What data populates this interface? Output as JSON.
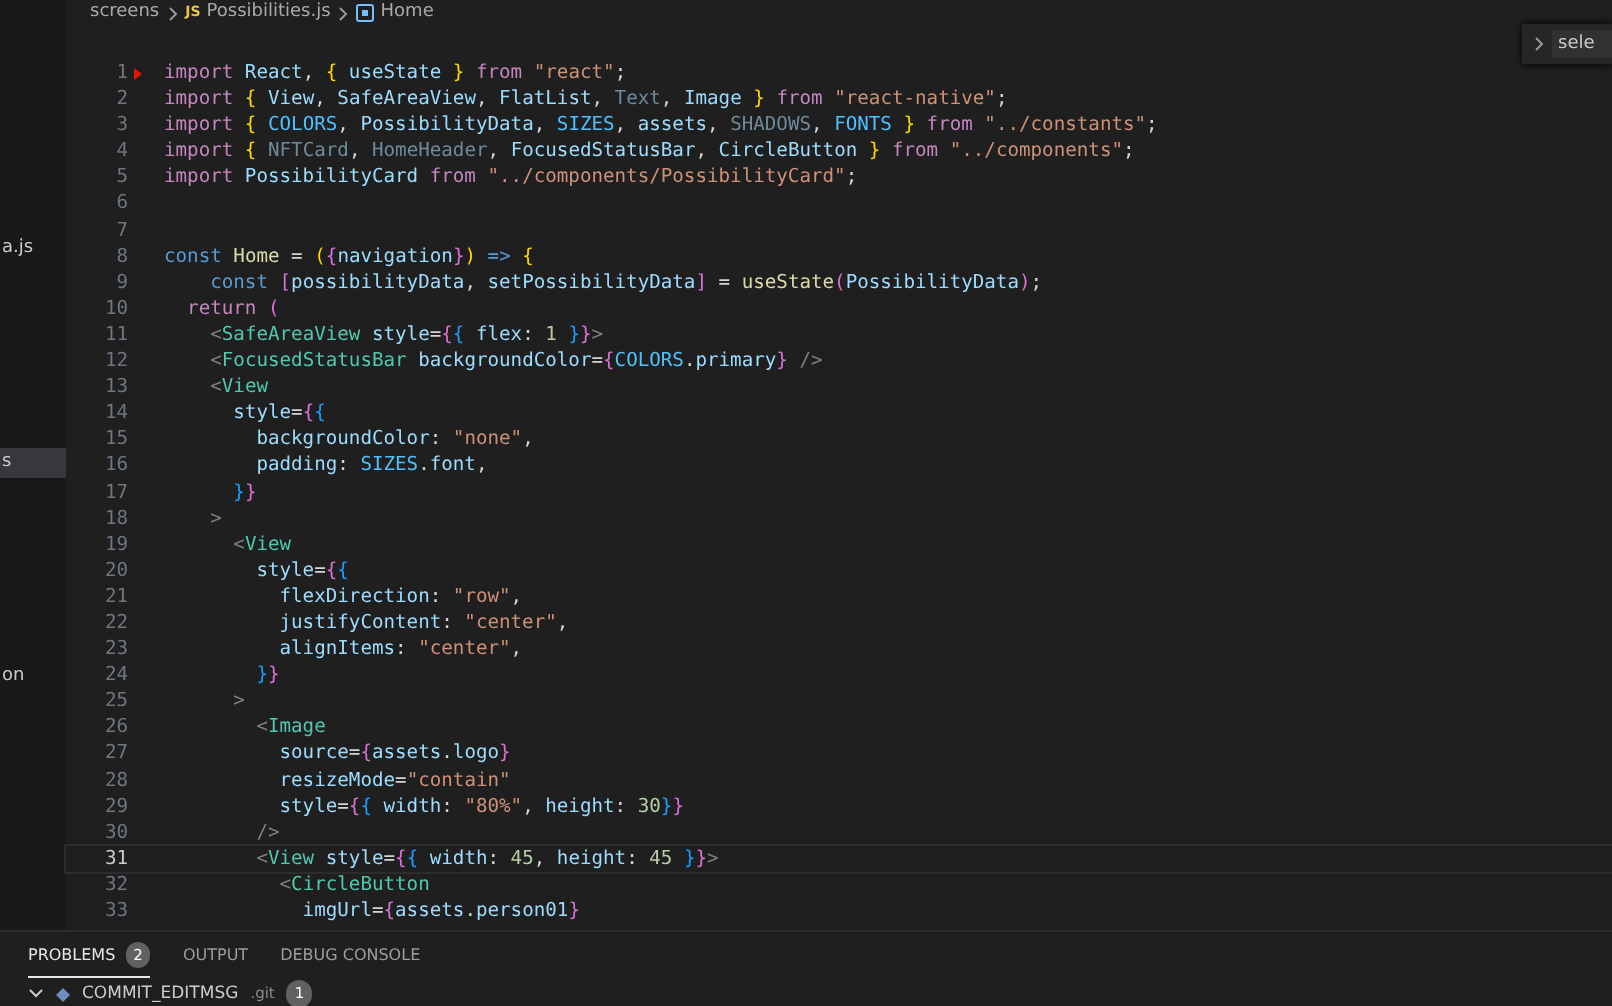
{
  "sidebar": {
    "items": [
      {
        "label": "a.js",
        "selected": false
      },
      {
        "label": "s",
        "selected": true
      },
      {
        "label": "on",
        "selected": false
      }
    ]
  },
  "breadcrumb": {
    "folder": "screens",
    "file_badge": "JS",
    "file": "Possibilities.js",
    "symbol": "Home"
  },
  "find_widget": {
    "value": "sele"
  },
  "editor": {
    "lines": [
      {
        "n": "1",
        "current": false,
        "flagged": true,
        "tokens": [
          {
            "kind": "kw",
            "text": "import"
          },
          {
            "kind": "var",
            "text": " React"
          },
          {
            "kind": "p",
            "text": ", "
          },
          {
            "kind": "b1",
            "text": "{"
          },
          {
            "kind": "var",
            "text": " useState "
          },
          {
            "kind": "b1",
            "text": "}"
          },
          {
            "kind": "kw",
            "text": " from"
          },
          {
            "kind": "str",
            "text": " \"react\""
          },
          {
            "kind": "p",
            "text": ";"
          }
        ]
      },
      {
        "n": "2",
        "current": false,
        "flagged": false,
        "tokens": [
          {
            "kind": "kw",
            "text": "import"
          },
          {
            "kind": "b1",
            "text": " {"
          },
          {
            "kind": "var",
            "text": " View"
          },
          {
            "kind": "p",
            "text": ","
          },
          {
            "kind": "var",
            "text": " SafeAreaView"
          },
          {
            "kind": "p",
            "text": ","
          },
          {
            "kind": "var",
            "text": " FlatList"
          },
          {
            "kind": "p",
            "text": ","
          },
          {
            "kind": "dim",
            "text": " Text"
          },
          {
            "kind": "p",
            "text": ","
          },
          {
            "kind": "var",
            "text": " Image"
          },
          {
            "kind": "b1",
            "text": " }"
          },
          {
            "kind": "kw",
            "text": " from"
          },
          {
            "kind": "str",
            "text": " \"react-native\""
          },
          {
            "kind": "p",
            "text": ";"
          }
        ]
      },
      {
        "n": "3",
        "current": false,
        "flagged": false,
        "tokens": [
          {
            "kind": "kw",
            "text": "import"
          },
          {
            "kind": "b1",
            "text": " {"
          },
          {
            "kind": "cst",
            "text": " COLORS"
          },
          {
            "kind": "p",
            "text": ","
          },
          {
            "kind": "var",
            "text": " PossibilityData"
          },
          {
            "kind": "p",
            "text": ","
          },
          {
            "kind": "cst",
            "text": " SIZES"
          },
          {
            "kind": "p",
            "text": ","
          },
          {
            "kind": "var",
            "text": " assets"
          },
          {
            "kind": "p",
            "text": ","
          },
          {
            "kind": "dim",
            "text": " SHADOWS"
          },
          {
            "kind": "p",
            "text": ","
          },
          {
            "kind": "cst",
            "text": " FONTS"
          },
          {
            "kind": "b1",
            "text": " }"
          },
          {
            "kind": "kw",
            "text": " from"
          },
          {
            "kind": "str",
            "text": " \"../constants\""
          },
          {
            "kind": "p",
            "text": ";"
          }
        ]
      },
      {
        "n": "4",
        "current": false,
        "flagged": false,
        "tokens": [
          {
            "kind": "kw",
            "text": "import"
          },
          {
            "kind": "b1",
            "text": " {"
          },
          {
            "kind": "dim",
            "text": " NFTCard"
          },
          {
            "kind": "p",
            "text": ","
          },
          {
            "kind": "dim",
            "text": " HomeHeader"
          },
          {
            "kind": "p",
            "text": ","
          },
          {
            "kind": "var",
            "text": " FocusedStatusBar"
          },
          {
            "kind": "p",
            "text": ","
          },
          {
            "kind": "var",
            "text": " CircleButton"
          },
          {
            "kind": "b1",
            "text": " }"
          },
          {
            "kind": "kw",
            "text": " from"
          },
          {
            "kind": "str",
            "text": " \"../components\""
          },
          {
            "kind": "p",
            "text": ";"
          }
        ]
      },
      {
        "n": "5",
        "current": false,
        "flagged": false,
        "tokens": [
          {
            "kind": "kw",
            "text": "import"
          },
          {
            "kind": "var",
            "text": " PossibilityCard"
          },
          {
            "kind": "kw",
            "text": " from"
          },
          {
            "kind": "str",
            "text": " \"../components/PossibilityCard\""
          },
          {
            "kind": "p",
            "text": ";"
          }
        ]
      },
      {
        "n": "6",
        "current": false,
        "flagged": false
      },
      {
        "n": "7",
        "current": false,
        "flagged": false
      },
      {
        "n": "8",
        "current": false,
        "flagged": false,
        "tokens": [
          {
            "kind": "kw2",
            "text": "const"
          },
          {
            "kind": "fn",
            "text": " Home"
          },
          {
            "kind": "p",
            "text": " ="
          },
          {
            "kind": "b1",
            "text": " ("
          },
          {
            "kind": "b2",
            "text": "{"
          },
          {
            "kind": "var",
            "text": "navigation"
          },
          {
            "kind": "b2",
            "text": "}"
          },
          {
            "kind": "b1",
            "text": ")"
          },
          {
            "kind": "kw2",
            "text": " =>"
          },
          {
            "kind": "b1",
            "text": " {"
          }
        ]
      },
      {
        "n": "9",
        "current": false,
        "flagged": false,
        "tokens": [
          {
            "kind": "kw2",
            "text": "    const"
          },
          {
            "kind": "b2",
            "text": " ["
          },
          {
            "kind": "var",
            "text": "possibilityData"
          },
          {
            "kind": "p",
            "text": ","
          },
          {
            "kind": "var",
            "text": " setPossibilityData"
          },
          {
            "kind": "b2",
            "text": "]"
          },
          {
            "kind": "p",
            "text": " ="
          },
          {
            "kind": "fn",
            "text": " useState"
          },
          {
            "kind": "b2",
            "text": "("
          },
          {
            "kind": "var",
            "text": "PossibilityData"
          },
          {
            "kind": "b2",
            "text": ")"
          },
          {
            "kind": "p",
            "text": ";"
          }
        ]
      },
      {
        "n": "10",
        "current": false,
        "flagged": false,
        "tokens": [
          {
            "kind": "kw",
            "text": "  return"
          },
          {
            "kind": "b2",
            "text": " ("
          }
        ]
      },
      {
        "n": "11",
        "current": false,
        "flagged": false,
        "tokens": [
          {
            "kind": "pu",
            "text": "    <"
          },
          {
            "kind": "tag",
            "text": "SafeAreaView"
          },
          {
            "kind": "var",
            "text": " style"
          },
          {
            "kind": "p",
            "text": "="
          },
          {
            "kind": "b2",
            "text": "{"
          },
          {
            "kind": "b3",
            "text": "{"
          },
          {
            "kind": "var",
            "text": " flex"
          },
          {
            "kind": "p",
            "text": ":"
          },
          {
            "kind": "num",
            "text": " 1"
          },
          {
            "kind": "b3",
            "text": " }"
          },
          {
            "kind": "b2",
            "text": "}"
          },
          {
            "kind": "pu",
            "text": ">"
          }
        ]
      },
      {
        "n": "12",
        "current": false,
        "flagged": false,
        "tokens": [
          {
            "kind": "pu",
            "text": "    <"
          },
          {
            "kind": "tag",
            "text": "FocusedStatusBar"
          },
          {
            "kind": "var",
            "text": " backgroundColor"
          },
          {
            "kind": "p",
            "text": "="
          },
          {
            "kind": "b2",
            "text": "{"
          },
          {
            "kind": "cst",
            "text": "COLORS"
          },
          {
            "kind": "p",
            "text": "."
          },
          {
            "kind": "var",
            "text": "primary"
          },
          {
            "kind": "b2",
            "text": "}"
          },
          {
            "kind": "pu",
            "text": " />"
          }
        ]
      },
      {
        "n": "13",
        "current": false,
        "flagged": false,
        "tokens": [
          {
            "kind": "pu",
            "text": "    <"
          },
          {
            "kind": "tag",
            "text": "View"
          }
        ]
      },
      {
        "n": "14",
        "current": false,
        "flagged": false,
        "tokens": [
          {
            "kind": "var",
            "text": "      style"
          },
          {
            "kind": "p",
            "text": "="
          },
          {
            "kind": "b2",
            "text": "{"
          },
          {
            "kind": "b3",
            "text": "{"
          }
        ]
      },
      {
        "n": "15",
        "current": false,
        "flagged": false,
        "tokens": [
          {
            "kind": "var",
            "text": "        backgroundColor"
          },
          {
            "kind": "p",
            "text": ":"
          },
          {
            "kind": "str",
            "text": " \"none\""
          },
          {
            "kind": "p",
            "text": ","
          }
        ]
      },
      {
        "n": "16",
        "current": false,
        "flagged": false,
        "tokens": [
          {
            "kind": "var",
            "text": "        padding"
          },
          {
            "kind": "p",
            "text": ":"
          },
          {
            "kind": "cst",
            "text": " SIZES"
          },
          {
            "kind": "p",
            "text": "."
          },
          {
            "kind": "var",
            "text": "font"
          },
          {
            "kind": "p",
            "text": ","
          }
        ]
      },
      {
        "n": "17",
        "current": false,
        "flagged": false,
        "tokens": [
          {
            "kind": "b3",
            "text": "      }"
          },
          {
            "kind": "b2",
            "text": "}"
          }
        ]
      },
      {
        "n": "18",
        "current": false,
        "flagged": false,
        "tokens": [
          {
            "kind": "pu",
            "text": "    >"
          }
        ]
      },
      {
        "n": "19",
        "current": false,
        "flagged": false,
        "tokens": [
          {
            "kind": "pu",
            "text": "      <"
          },
          {
            "kind": "tag",
            "text": "View"
          }
        ]
      },
      {
        "n": "20",
        "current": false,
        "flagged": false,
        "tokens": [
          {
            "kind": "var",
            "text": "        style"
          },
          {
            "kind": "p",
            "text": "="
          },
          {
            "kind": "b2",
            "text": "{"
          },
          {
            "kind": "b3",
            "text": "{"
          }
        ]
      },
      {
        "n": "21",
        "current": false,
        "flagged": false,
        "tokens": [
          {
            "kind": "var",
            "text": "          flexDirection"
          },
          {
            "kind": "p",
            "text": ":"
          },
          {
            "kind": "str",
            "text": " \"row\""
          },
          {
            "kind": "p",
            "text": ","
          }
        ]
      },
      {
        "n": "22",
        "current": false,
        "flagged": false,
        "tokens": [
          {
            "kind": "var",
            "text": "          justifyContent"
          },
          {
            "kind": "p",
            "text": ":"
          },
          {
            "kind": "str",
            "text": " \"center\""
          },
          {
            "kind": "p",
            "text": ","
          }
        ]
      },
      {
        "n": "23",
        "current": false,
        "flagged": false,
        "tokens": [
          {
            "kind": "var",
            "text": "          alignItems"
          },
          {
            "kind": "p",
            "text": ":"
          },
          {
            "kind": "str",
            "text": " \"center\""
          },
          {
            "kind": "p",
            "text": ","
          }
        ]
      },
      {
        "n": "24",
        "current": false,
        "flagged": false,
        "tokens": [
          {
            "kind": "b3",
            "text": "        }"
          },
          {
            "kind": "b2",
            "text": "}"
          }
        ]
      },
      {
        "n": "25",
        "current": false,
        "flagged": false,
        "tokens": [
          {
            "kind": "pu",
            "text": "      >"
          }
        ]
      },
      {
        "n": "26",
        "current": false,
        "flagged": false,
        "tokens": [
          {
            "kind": "pu",
            "text": "        <"
          },
          {
            "kind": "tag",
            "text": "Image"
          }
        ]
      },
      {
        "n": "27",
        "current": false,
        "flagged": false,
        "tokens": [
          {
            "kind": "var",
            "text": "          source"
          },
          {
            "kind": "p",
            "text": "="
          },
          {
            "kind": "b2",
            "text": "{"
          },
          {
            "kind": "var",
            "text": "assets"
          },
          {
            "kind": "p",
            "text": "."
          },
          {
            "kind": "var",
            "text": "logo"
          },
          {
            "kind": "b2",
            "text": "}"
          }
        ]
      },
      {
        "n": "28",
        "current": false,
        "flagged": false,
        "tokens": [
          {
            "kind": "var",
            "text": "          resizeMode"
          },
          {
            "kind": "p",
            "text": "="
          },
          {
            "kind": "str",
            "text": "\"contain\""
          }
        ]
      },
      {
        "n": "29",
        "current": false,
        "flagged": false,
        "tokens": [
          {
            "kind": "var",
            "text": "          style"
          },
          {
            "kind": "p",
            "text": "="
          },
          {
            "kind": "b2",
            "text": "{"
          },
          {
            "kind": "b3",
            "text": "{"
          },
          {
            "kind": "var",
            "text": " width"
          },
          {
            "kind": "p",
            "text": ":"
          },
          {
            "kind": "str",
            "text": " \"80%\""
          },
          {
            "kind": "p",
            "text": ","
          },
          {
            "kind": "var",
            "text": " height"
          },
          {
            "kind": "p",
            "text": ":"
          },
          {
            "kind": "num",
            "text": " 30"
          },
          {
            "kind": "b3",
            "text": "}"
          },
          {
            "kind": "b2",
            "text": "}"
          }
        ]
      },
      {
        "n": "30",
        "current": false,
        "flagged": false,
        "tokens": [
          {
            "kind": "pu",
            "text": "        />"
          }
        ]
      },
      {
        "n": "31",
        "current": true,
        "flagged": false,
        "tokens": [
          {
            "kind": "pu",
            "text": "        <"
          },
          {
            "kind": "tag",
            "text": "View"
          },
          {
            "kind": "var",
            "text": " style"
          },
          {
            "kind": "p",
            "text": "="
          },
          {
            "kind": "b2",
            "text": "{"
          },
          {
            "kind": "b3",
            "text": "{"
          },
          {
            "kind": "var",
            "text": " width"
          },
          {
            "kind": "p",
            "text": ":"
          },
          {
            "kind": "num",
            "text": " 45"
          },
          {
            "kind": "p",
            "text": ","
          },
          {
            "kind": "var",
            "text": " height"
          },
          {
            "kind": "p",
            "text": ":"
          },
          {
            "kind": "num",
            "text": " 45"
          },
          {
            "kind": "b3",
            "text": " }"
          },
          {
            "kind": "b2",
            "text": "}"
          },
          {
            "kind": "pu",
            "text": ">"
          }
        ]
      },
      {
        "n": "32",
        "current": false,
        "flagged": false,
        "tokens": [
          {
            "kind": "pu",
            "text": "          <"
          },
          {
            "kind": "tag",
            "text": "CircleButton"
          }
        ]
      },
      {
        "n": "33",
        "current": false,
        "flagged": false,
        "tokens": [
          {
            "kind": "var",
            "text": "            imgUrl"
          },
          {
            "kind": "p",
            "text": "="
          },
          {
            "kind": "b2",
            "text": "{"
          },
          {
            "kind": "var",
            "text": "assets"
          },
          {
            "kind": "p",
            "text": "."
          },
          {
            "kind": "var",
            "text": "person01"
          },
          {
            "kind": "b2",
            "text": "}"
          }
        ]
      }
    ]
  },
  "panel": {
    "tabs": [
      {
        "label": "PROBLEMS",
        "count": "2",
        "selected": true
      },
      {
        "label": "OUTPUT",
        "selected": false
      },
      {
        "label": "DEBUG CONSOLE",
        "selected": false
      }
    ],
    "problems": [
      {
        "file": "COMMIT_EDITMSG",
        "folder": ".git",
        "count": "1",
        "expanded": true
      }
    ]
  }
}
